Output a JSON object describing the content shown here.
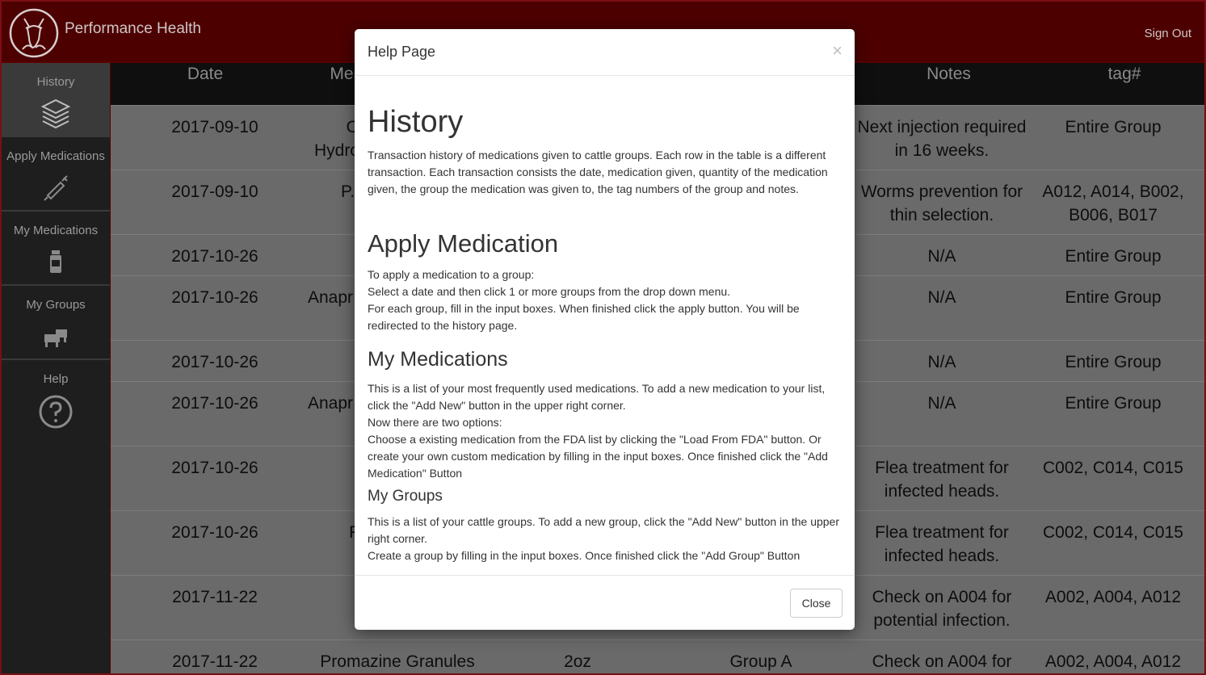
{
  "header": {
    "brand": "Performance Health",
    "sign_out": "Sign Out",
    "logo_icon": "deer-head-logo-icon"
  },
  "sidebar": {
    "items": [
      {
        "label": "History",
        "icon": "stack-layers-icon",
        "active": true
      },
      {
        "label": "Apply Medications",
        "icon": "syringe-icon",
        "active": false
      },
      {
        "label": "My Medications",
        "icon": "medicine-bottle-icon",
        "active": false
      },
      {
        "label": "My Groups",
        "icon": "cattle-icon",
        "active": false
      },
      {
        "label": "Help",
        "icon": "question-circle-icon",
        "active": false
      }
    ]
  },
  "table": {
    "headers": [
      "Date",
      "Me",
      "Notes",
      "tag#"
    ],
    "rows": [
      {
        "date": "2017-09-10",
        "med": "O\nHydro",
        "notes": "Next injection required in 16 weeks.",
        "tags": "Entire Group"
      },
      {
        "date": "2017-09-10",
        "med": "P.I",
        "notes": "Worms prevention for thin selection.",
        "tags": "A012, A014, B002, B006, B017"
      },
      {
        "date": "2017-10-26",
        "med": "",
        "notes": "N/A",
        "tags": "Entire Group"
      },
      {
        "date": "2017-10-26",
        "med": "Anapr",
        "notes": "N/A",
        "tags": "Entire Group"
      },
      {
        "date": "2017-10-26",
        "med": "",
        "notes": "N/A",
        "tags": "Entire Group"
      },
      {
        "date": "2017-10-26",
        "med": "Anapr",
        "notes": "N/A",
        "tags": "Entire Group"
      },
      {
        "date": "2017-10-26",
        "med": "",
        "notes": "Flea treatment for infected heads.",
        "tags": "C002, C014, C015"
      },
      {
        "date": "2017-10-26",
        "med": "F",
        "notes": "Flea treatment for infected heads.",
        "tags": "C002, C014, C015"
      },
      {
        "date": "2017-11-22",
        "med": "",
        "notes": "Check on A004 for potential infection.",
        "tags": "A002, A004, A012"
      },
      {
        "date": "2017-11-22",
        "med": "Promazine Granules",
        "qty": "2oz",
        "group": "Group A",
        "notes": "Check on A004 for",
        "tags": "A002, A004, A012"
      }
    ]
  },
  "modal": {
    "title": "Help Page",
    "close_x": "×",
    "close_button": "Close",
    "sections": [
      {
        "heading": "History",
        "text": "Transaction history of medications given to cattle groups. Each row in the table is a different transaction. Each transaction consists the date, medication given, quantity of the medication given, the group the medication was given to, the tag numbers of the group and notes."
      },
      {
        "heading": "Apply Medication",
        "lines": [
          "To apply a medication to a group:",
          "Select a date and then click 1 or more groups from the drop down menu.",
          "For each group, fill in the input boxes. When finished click the apply button. You will be redirected to the history page."
        ]
      },
      {
        "heading": "My Medications",
        "lines": [
          "This is a list of your most frequently used medications. To add a new medication to your list, click the \"Add New\" button in the upper right corner.",
          "Now there are two options:",
          "Choose a existing medication from the FDA list by clicking the \"Load From FDA\" button. Or create your own custom medication by filling in the input boxes. Once finished click the \"Add Medication\" Button"
        ]
      },
      {
        "heading": "My Groups",
        "lines": [
          "This is a list of your cattle groups. To add a new group, click the \"Add New\" button in the upper right corner.",
          "Create a group by filling in the input boxes. Once finished click the \"Add Group\" Button"
        ]
      }
    ]
  },
  "colors": {
    "header_bg": "#4d0000",
    "border": "#7a0f14",
    "sidebar_bg": "#1e1e1e"
  }
}
